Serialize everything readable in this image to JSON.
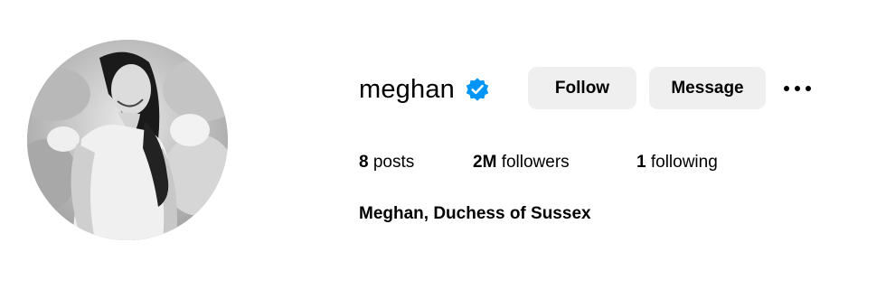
{
  "profile": {
    "username": "meghan",
    "verified": true,
    "verified_badge_color": "#0095f6",
    "full_name": "Meghan, Duchess of Sussex",
    "avatar_icon": "profile-photo"
  },
  "actions": {
    "follow_label": "Follow",
    "message_label": "Message",
    "more_icon": "more-horizontal-icon"
  },
  "stats": {
    "posts": {
      "count": "8",
      "label": "posts"
    },
    "followers": {
      "count": "2M",
      "label": "followers"
    },
    "following": {
      "count": "1",
      "label": "following"
    }
  },
  "colors": {
    "button_bg": "#efefef",
    "text": "#000000",
    "background": "#ffffff"
  }
}
